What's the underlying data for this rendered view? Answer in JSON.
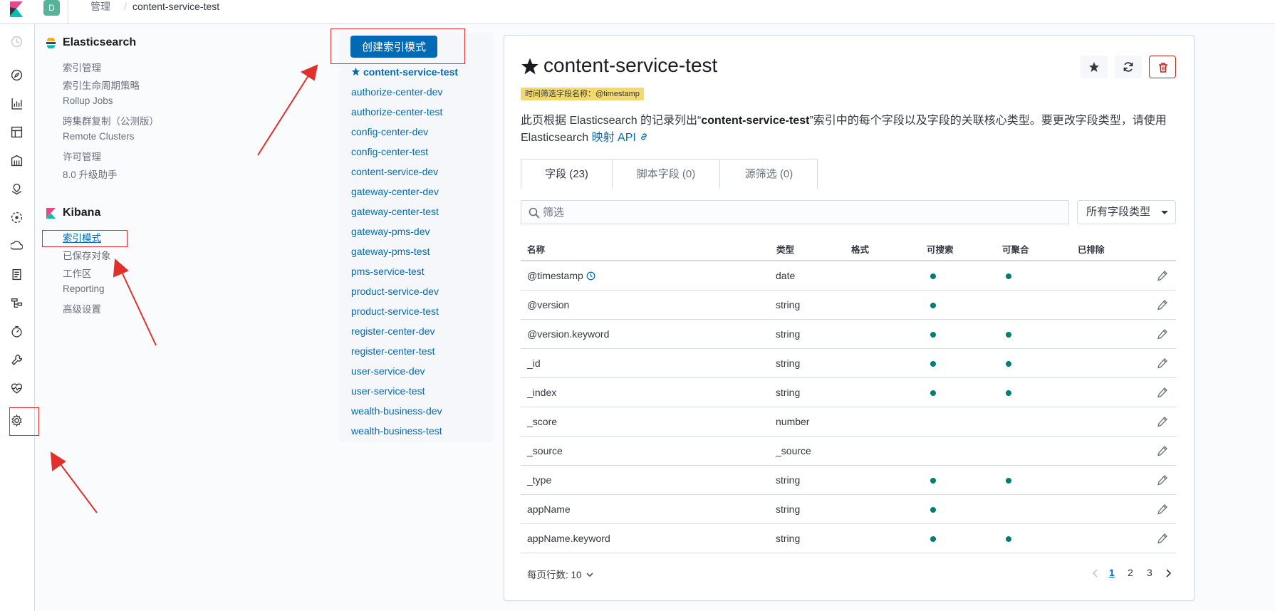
{
  "header": {
    "space_initial": "D",
    "breadcrumb": [
      "管理",
      "content-service-test"
    ]
  },
  "side_nav": {
    "elasticsearch": {
      "title": "Elasticsearch",
      "items": [
        "索引管理",
        "索引生命周期策略",
        "Rollup Jobs",
        "跨集群复制（公测版）",
        "Remote Clusters",
        "许可管理",
        "8.0 升级助手"
      ]
    },
    "kibana": {
      "title": "Kibana",
      "items": [
        "索引模式",
        "已保存对象",
        "工作区",
        "Reporting",
        "高级设置"
      ],
      "active": "索引模式"
    }
  },
  "index_patterns": {
    "create_button": "创建索引模式",
    "items": [
      "content-service-test",
      "authorize-center-dev",
      "authorize-center-test",
      "config-center-dev",
      "config-center-test",
      "content-service-dev",
      "gateway-center-dev",
      "gateway-center-test",
      "gateway-pms-dev",
      "gateway-pms-test",
      "pms-service-test",
      "product-service-dev",
      "product-service-test",
      "register-center-dev",
      "register-center-test",
      "user-service-dev",
      "user-service-test",
      "wealth-business-dev",
      "wealth-business-test"
    ],
    "default": "content-service-test"
  },
  "main": {
    "title": "content-service-test",
    "time_filter_badge": "时间筛选字段名称：@timestamp",
    "description_pre": "此页根据 Elasticsearch 的记录列出“",
    "description_bold": "content-service-test",
    "description_mid": "”索引中的每个字段以及字段的关联核心类型。要更改字段类型，请使用 Elasticsearch ",
    "description_link": "映射 API",
    "tabs": [
      "字段 (23)",
      "脚本字段 (0)",
      "源筛选 (0)"
    ],
    "filter_placeholder": "筛选",
    "type_select": "所有字段类型",
    "columns": [
      "名称",
      "类型",
      "格式",
      "可搜索",
      "可聚合",
      "已排除"
    ],
    "rows": [
      {
        "name": "@timestamp",
        "type": "date",
        "searchable": true,
        "aggregatable": true,
        "time_field": true
      },
      {
        "name": "@version",
        "type": "string",
        "searchable": true,
        "aggregatable": false
      },
      {
        "name": "@version.keyword",
        "type": "string",
        "searchable": true,
        "aggregatable": true
      },
      {
        "name": "_id",
        "type": "string",
        "searchable": true,
        "aggregatable": true
      },
      {
        "name": "_index",
        "type": "string",
        "searchable": true,
        "aggregatable": true
      },
      {
        "name": "_score",
        "type": "number",
        "searchable": false,
        "aggregatable": false
      },
      {
        "name": "_source",
        "type": "_source",
        "searchable": false,
        "aggregatable": false
      },
      {
        "name": "_type",
        "type": "string",
        "searchable": true,
        "aggregatable": true
      },
      {
        "name": "appName",
        "type": "string",
        "searchable": true,
        "aggregatable": false
      },
      {
        "name": "appName.keyword",
        "type": "string",
        "searchable": true,
        "aggregatable": true
      }
    ],
    "rows_per_page": "每页行数: 10",
    "pages": [
      "1",
      "2",
      "3"
    ],
    "current_page": "1"
  },
  "colors": {
    "accent": "#006bb4",
    "dot": "#017d73",
    "badge": "#f1d86f",
    "danger": "#bd271e",
    "annotation": "#e0302c"
  }
}
